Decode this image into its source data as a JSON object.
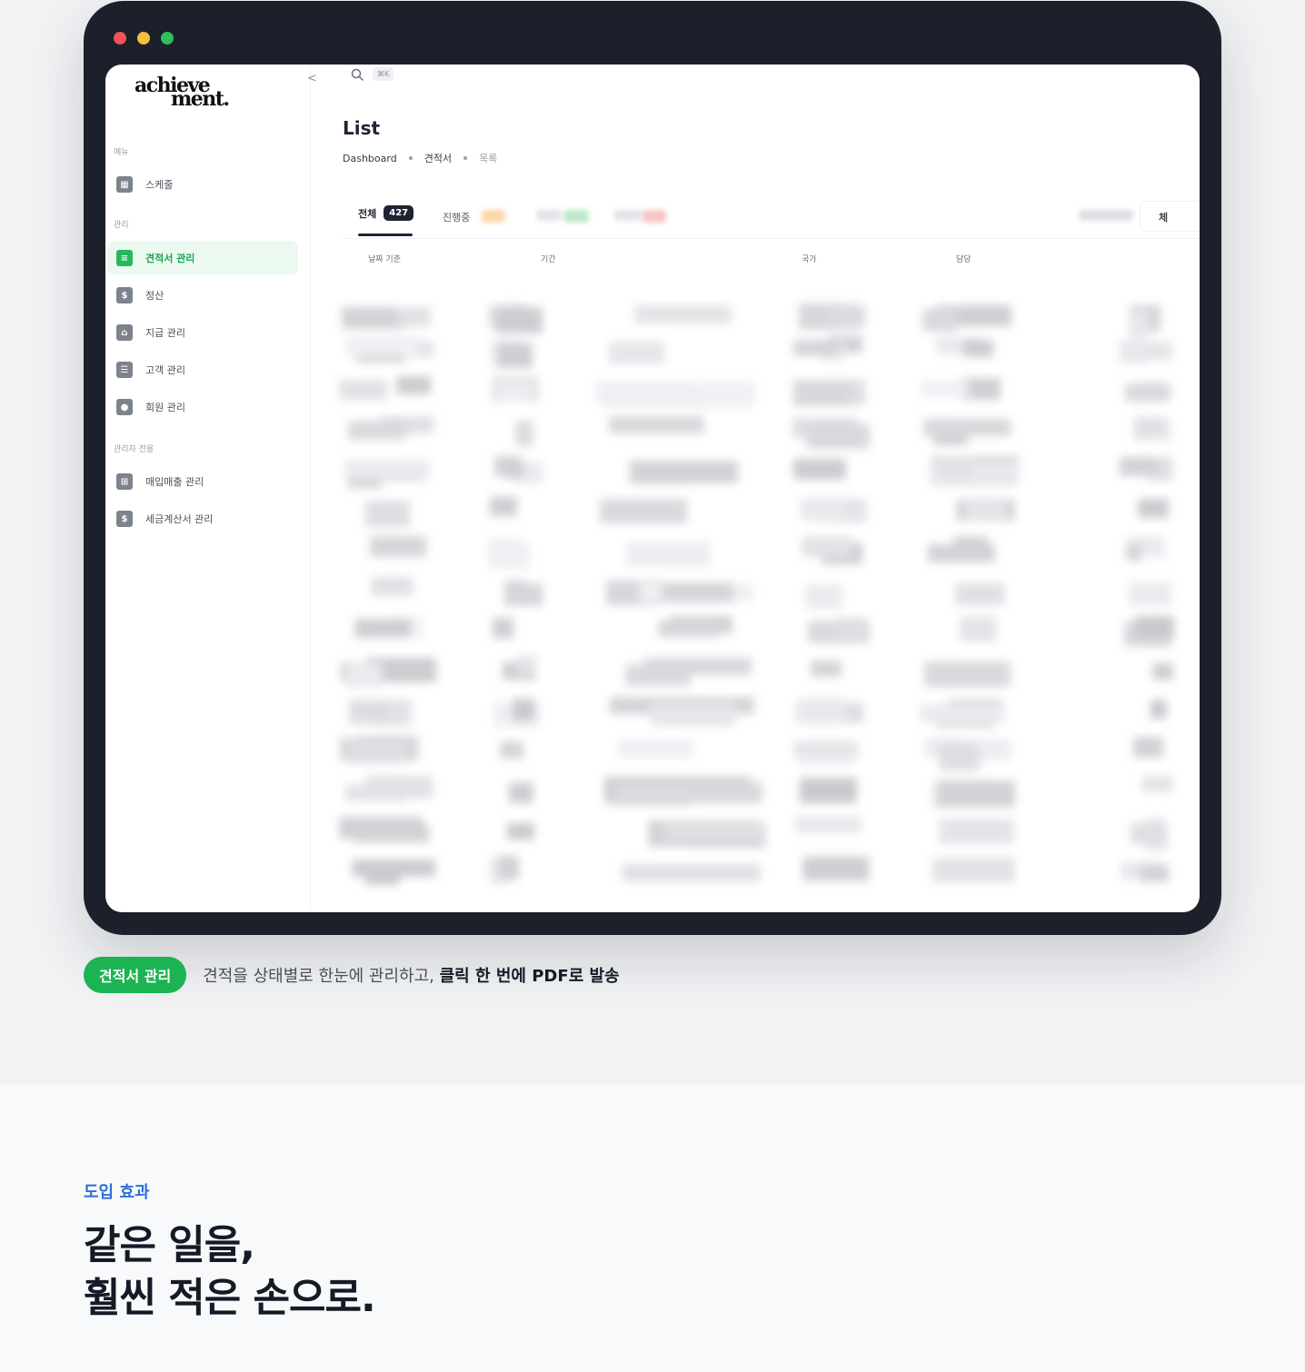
{
  "colors": {
    "accent_green": "#1cb352",
    "accent_blue": "#2f6fd6",
    "device_frame": "#1b202b",
    "text_dark": "#141a26"
  },
  "sidebar": {
    "logo_line1": "achieve",
    "logo_line2": "ment.",
    "collapse_icon": "<",
    "sections": [
      {
        "label": "메뉴"
      },
      {
        "label": "관리"
      },
      {
        "label": "관리자 전용"
      }
    ],
    "items": [
      {
        "label": "스케줄",
        "icon": "calendar-icon",
        "glyph": "▦"
      },
      {
        "label": "견적서 관리",
        "icon": "document-icon",
        "glyph": "≡",
        "active": true
      },
      {
        "label": "정산",
        "icon": "dollar-icon",
        "glyph": "$"
      },
      {
        "label": "지급 관리",
        "icon": "bank-icon",
        "glyph": "⌂"
      },
      {
        "label": "고객 관리",
        "icon": "customers-icon",
        "glyph": "☰"
      },
      {
        "label": "회원 관리",
        "icon": "user-icon",
        "glyph": "●"
      },
      {
        "label": "매입매출 관리",
        "icon": "cart-icon",
        "glyph": "⊞"
      },
      {
        "label": "세금계산서 관리",
        "icon": "invoice-icon",
        "glyph": "$"
      }
    ]
  },
  "topbar": {
    "search_shortcut": "⌘K"
  },
  "page": {
    "title": "List",
    "breadcrumb": [
      "Dashboard",
      "견적서",
      "목록"
    ]
  },
  "tabs": {
    "all_label": "전체",
    "all_count": "427",
    "in_progress_label": "진행중",
    "corner_label": "체"
  },
  "columns": [
    "날짜 기준",
    "기간",
    "국가",
    "담당"
  ],
  "caption": {
    "badge": "견적서 관리",
    "text_plain": "견적을 상태별로 한눈에 관리하고, ",
    "text_strong": "클릭 한 번에 PDF로 발송"
  },
  "section": {
    "kicker": "도입 효과",
    "headline_line1": "같은 일을,",
    "headline_line2": "훨씬 적은 손으로."
  }
}
